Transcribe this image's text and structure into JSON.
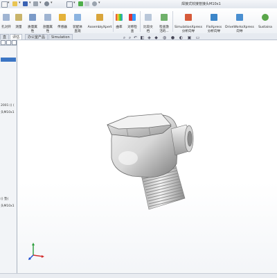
{
  "window": {
    "title": "焊接式铰接管接头M10x1"
  },
  "ribbon": {
    "buttons": [
      {
        "label": "孔对开",
        "icon": "hole-icon"
      },
      {
        "label": "测量",
        "icon": "measure-icon"
      },
      {
        "label": "质量属\n性",
        "icon": "mass-properties-icon"
      },
      {
        "label": "剖面属\n性",
        "icon": "section-properties-icon"
      },
      {
        "label": "传感器",
        "icon": "sensor-icon"
      },
      {
        "label": "装配体\n直观",
        "icon": "assembly-visualization-icon"
      },
      {
        "label": "AssemblyXpert",
        "icon": "assemblyxpert-icon"
      },
      {
        "label": "曲率",
        "icon": "curvature-icon"
      },
      {
        "label": "对称检\n查",
        "icon": "symmetry-check-icon"
      },
      {
        "label": "比较文\n档",
        "icon": "compare-documents-icon"
      },
      {
        "label": "检查激\n活的...",
        "icon": "check-active-document-icon"
      },
      {
        "label": "SimulationXpress\n分析向导",
        "icon": "simulationxpress-icon"
      },
      {
        "label": "FloXpress\n分析向导",
        "icon": "floxpress-icon"
      },
      {
        "label": "DriveWorksXpress\n向导",
        "icon": "driveworksxpress-icon"
      },
      {
        "label": "Sustaina",
        "icon": "sustainability-icon"
      }
    ]
  },
  "tabs": [
    "直",
    "评估",
    "办公室产品",
    "Simulation"
  ],
  "tree": {
    "lines": [
      "2001 () (",
      "头M10x1",
      "() 垫(",
      "头M10x1"
    ]
  },
  "colors": {
    "accent": "#3b75c4",
    "model_metal": "#d4d4d4"
  }
}
